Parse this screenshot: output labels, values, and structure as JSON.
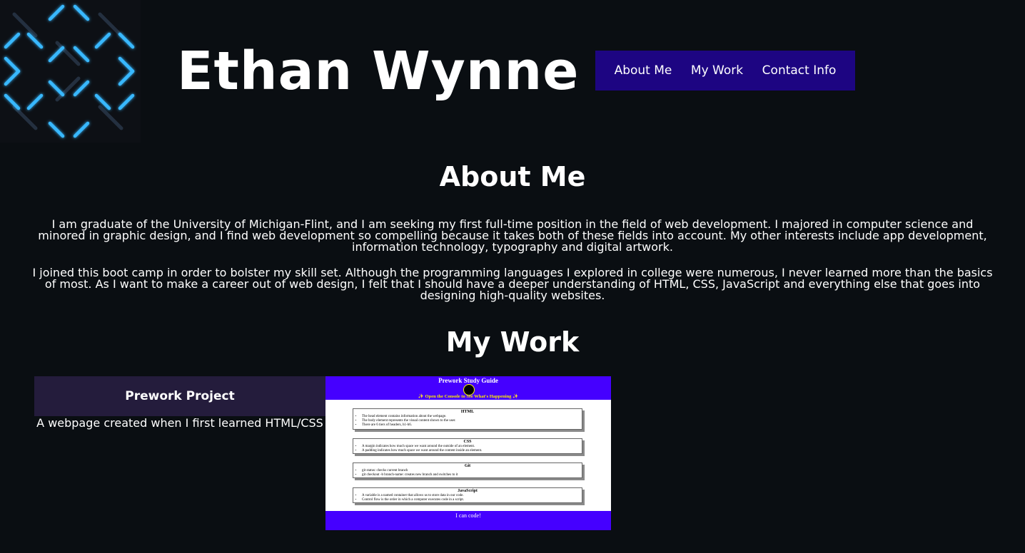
{
  "header": {
    "name": "Ethan Wynne",
    "nav": [
      {
        "label": "About Me"
      },
      {
        "label": "My Work"
      },
      {
        "label": "Contact Info"
      }
    ]
  },
  "about": {
    "title": "About Me",
    "paragraphs": [
      "I am graduate of the University of Michigan-Flint, and I am seeking my first full-time position in the field of web development. I majored in computer science and minored in graphic design, and I find web development so compelling because it takes both of these fields into account. My other interests include app development, information technology, typography and digital artwork.",
      "I joined this boot camp in order to bolster my skill set. Although the programming languages I explored in college were numerous, I never learned more than the basics of most. As I want to make a career out of web design, I felt that I should have a deeper understanding of HTML, CSS, JavaScript and everything else that goes into designing high-quality websites."
    ]
  },
  "work": {
    "title": "My Work",
    "project": {
      "title": "Prework Project",
      "description": "A webpage created when I first learned HTML/CSS",
      "thumbnail": {
        "title": "Prework Study Guide",
        "subtitle": "✨ Open the Console to See What's Happening ✨",
        "sections": [
          {
            "title": "HTML",
            "items": [
              "The head element contains information about the webpage.",
              "The body element represents the visual content shown to the user.",
              "There are 6 tiers of headers, h1-h6."
            ]
          },
          {
            "title": "CSS",
            "items": [
              "A margin indicates how much space we want around the outside of an element.",
              "A padding indicates how much space we want around the content inside an element."
            ]
          },
          {
            "title": "Git",
            "items": [
              "git status: checks current branch",
              "git checkout -b branch-name: creates new branch and switches to it"
            ]
          },
          {
            "title": "JavaScript",
            "items": [
              "A variable is a named container that allows us to store data in our code.",
              "Control flow is the order in which a computer executes code in a script."
            ]
          }
        ],
        "footer": "I can code!"
      }
    }
  },
  "colors": {
    "background": "#0a0e12",
    "nav": "#1d0582",
    "project_header": "#241c3c",
    "thumb_accent": "#4500ff",
    "logo_glow": "#39b8ff"
  },
  "icons": {
    "logo": "neon-lattice-logo"
  }
}
